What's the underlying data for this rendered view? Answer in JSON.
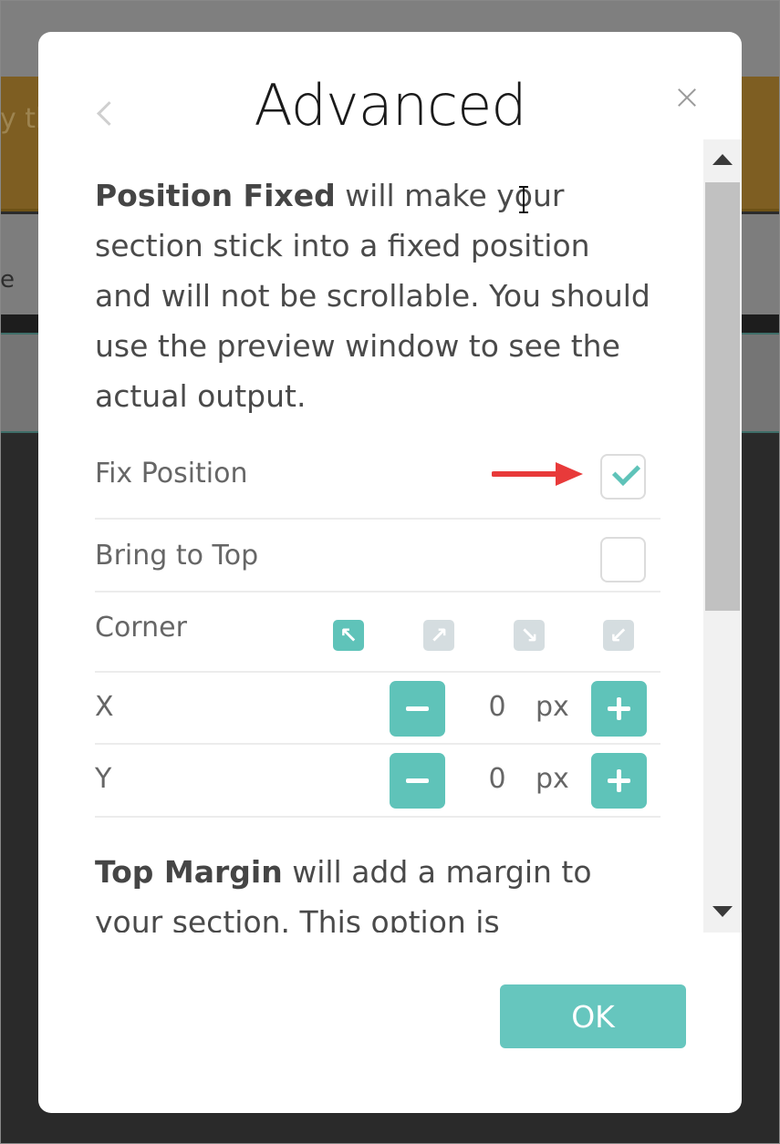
{
  "background": {
    "banner_text": "y th",
    "band_text": "e"
  },
  "modal": {
    "title": "Advanced",
    "back_icon": "chevron-left-icon",
    "close_icon": "close-icon"
  },
  "position_fixed": {
    "bold": "Position Fixed",
    "text": " will make your section stick into a fixed position and will not be scrollable. You should use the preview window to see the actual output."
  },
  "options": {
    "fix_position": {
      "label": "Fix Position",
      "checked": true
    },
    "bring_to_top": {
      "label": "Bring to Top",
      "checked": false
    },
    "corner": {
      "label": "Corner",
      "items": [
        {
          "name": "corner-top-left",
          "glyph": "↖",
          "active": true
        },
        {
          "name": "corner-top-right",
          "glyph": "↗",
          "active": false
        },
        {
          "name": "corner-bottom-right",
          "glyph": "↘",
          "active": false
        },
        {
          "name": "corner-bottom-left",
          "glyph": "↙",
          "active": false
        }
      ]
    },
    "x": {
      "label": "X",
      "value": "0",
      "unit": "px"
    },
    "y": {
      "label": "Y",
      "value": "0",
      "unit": "px"
    }
  },
  "top_margin": {
    "bold": "Top Margin",
    "text": " will add a margin to your section. This option is"
  },
  "ok_button": "OK",
  "colors": {
    "accent": "#5fc3b9",
    "annotation": "#e83a3a"
  }
}
